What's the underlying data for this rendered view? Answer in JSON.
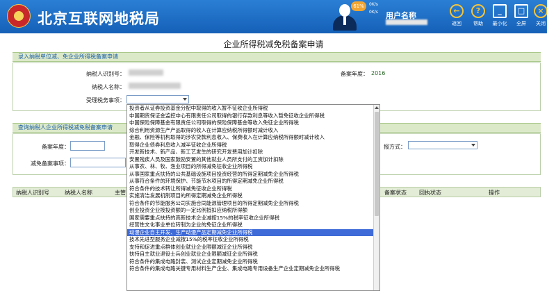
{
  "header": {
    "site_title": "北京互联网地税局",
    "username": "用户名称",
    "net_speed_pct": "61%",
    "net_up": "0K/s",
    "net_down": "0K/s",
    "buttons": [
      {
        "label": "返回",
        "glyph": "←",
        "icon": "back-arrow-icon"
      },
      {
        "label": "帮助",
        "glyph": "?",
        "icon": "help-icon"
      },
      {
        "label": "最小化",
        "glyph": "_",
        "icon": "minimize-icon"
      },
      {
        "label": "全屏",
        "glyph": "□",
        "icon": "fullscreen-icon"
      },
      {
        "label": "关闭",
        "glyph": "×",
        "icon": "close-icon"
      }
    ],
    "colors": {
      "bar": "#1f6fc6",
      "accent": "#f5c43a"
    }
  },
  "page_title": "企业所得税减免税备案申请",
  "entry_section": {
    "title": "录入纳税单位减、免企业所得税备案申请",
    "taxpayer_id_label": "纳税人识别号：",
    "taxpayer_name_label": "纳税人名称：",
    "tax_item_label": "受理税务事项：",
    "year_label": "备案年度：",
    "year_value": "2016"
  },
  "query_section": {
    "title": "查询纳税人企业所得税减免税备案申请",
    "year_label": "备案年度：",
    "item_label": "减免备案事项：",
    "method_label": "报方式："
  },
  "table": {
    "columns": [
      "纳税人识别号",
      "纳税人名称",
      "主管",
      "备案状态",
      "回执状态",
      "操作"
    ]
  },
  "dropdown": {
    "selected_index": 17,
    "items": [
      "投资者从证券投资基金分配中取得的收入暂不征收企业所得税",
      "中国期货保证金监控中心有限责任公司取得的银行存款利息等收入暂免征收企业所得税",
      "中国保险保障基金有限责任公司取得的保险保障基金等收入免征企业所得税",
      "综合利用资源生产产品取得的收入在计算应纳税所得额时减计收入",
      "金融、保险等机构取得的涉农贷款利息收入、保费收入在计算应纳税所得额时减计收入",
      "取得企业债券利息收入减半征收企业所得税",
      "开发新技术、新产品、新工艺发生的研究开发费用加计扣除",
      "安置残疾人员及国家鼓励安置的其他就业人员所支付的工资加计扣除",
      "从事农、林、牧、渔业项目的所得减免征收企业所得税",
      "从事国家重点扶持的公共基础设施项目投资经营的所得定期减免企业所得税",
      "从事符合条件的环境保护、节能节水项目的所得定期减免企业所得税",
      "符合条件的技术转让所得减免征收企业所得税",
      "实施清洁发展机制项目的所得定期减免企业所得税",
      "符合条件的节能服务公司实施合同能源管理项目的所得定期减免企业所得税",
      "创业投资企业按投资额的一定比例抵扣应纳税所得额",
      "国家需要重点扶持的高新技术企业减按15%的税率征收企业所得税",
      "经营性文化事业单位转制为企业的免征企业所得税",
      "动漫企业自主开发、生产动漫产品定期减免企业所得税",
      "技术先进型服务企业减按15%的税率征收企业所得税",
      "支持和促进重点群体创业就业企业限额减征企业所得税",
      "扶持自主就业退役士兵创业就业企业限额减征企业所得税",
      "符合条件的集成电路封装、测试企业定期减免企业所得税",
      "符合条件的集成电路关键专用材料生产企业、集成电路专用设备生产企业定期减免企业所得税"
    ]
  }
}
